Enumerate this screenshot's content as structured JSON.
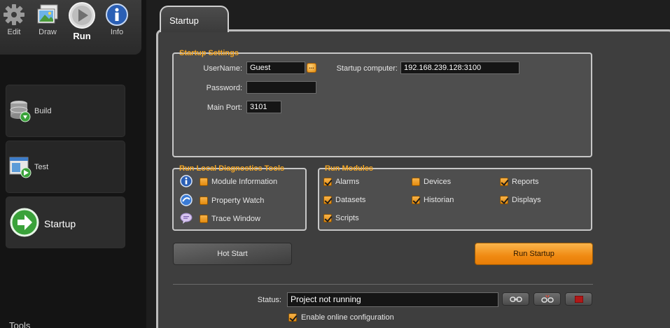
{
  "toolbar": {
    "edit": "Edit",
    "draw": "Draw",
    "run": "Run",
    "info": "Info"
  },
  "nav": {
    "build": "Build",
    "test": "Test",
    "startup": "Startup",
    "tools": "Tools"
  },
  "tab": {
    "title": "Startup"
  },
  "startup_settings": {
    "title": "Startup Settings",
    "username_label": "UserName:",
    "username_value": "Guest",
    "lookup_glyph": "...",
    "password_label": "Password:",
    "password_value": "",
    "main_port_label": "Main Port:",
    "main_port_value": "3101",
    "startup_computer_label": "Startup computer:",
    "startup_computer_value": "192.168.239.128:3100"
  },
  "diagnostics": {
    "title": "Run Local Diagnostics Tools",
    "items": [
      {
        "label": "Module Information",
        "checked": false,
        "icon": "info-icon"
      },
      {
        "label": "Property Watch",
        "checked": false,
        "icon": "watch-icon"
      },
      {
        "label": "Trace Window",
        "checked": false,
        "icon": "speech-bubble-icon"
      }
    ]
  },
  "modules": {
    "title": "Run Modules",
    "items": [
      {
        "label": "Alarms",
        "checked": true
      },
      {
        "label": "Devices",
        "checked": false
      },
      {
        "label": "Reports",
        "checked": true
      },
      {
        "label": "Datasets",
        "checked": true
      },
      {
        "label": "Historian",
        "checked": true
      },
      {
        "label": "Displays",
        "checked": true
      },
      {
        "label": "Scripts",
        "checked": true
      }
    ]
  },
  "actions": {
    "hot_start": "Hot Start",
    "run_startup": "Run Startup"
  },
  "status": {
    "label": "Status:",
    "value": "Project not running",
    "online_config_label": "Enable online configuration",
    "online_config_checked": true
  },
  "colors": {
    "accent": "#f5a623",
    "panel": "#4e4e4e",
    "background": "#1e1e1e"
  }
}
